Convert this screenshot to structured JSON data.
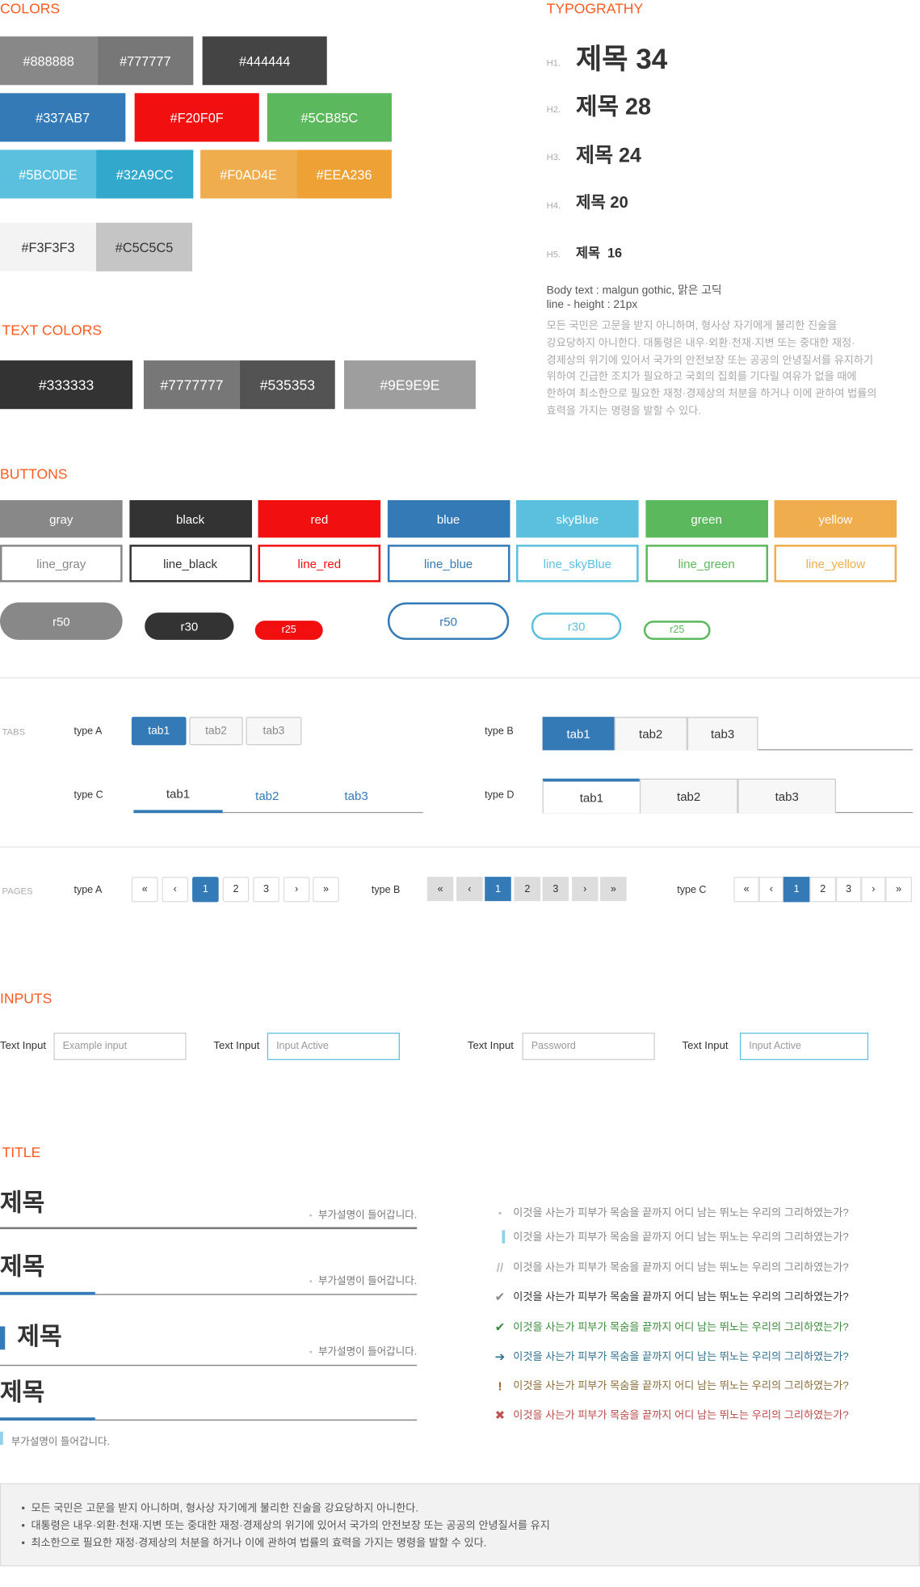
{
  "sections": {
    "colors": "COLORS",
    "text_colors": "TEXT COLORS",
    "typography": "TYPOGRATHY",
    "buttons": "BUTTONS",
    "tabs": "TABS",
    "pages": "PAGES",
    "inputs": "INPUTS",
    "title": "TITLE"
  },
  "colors": [
    {
      "label": "#888888",
      "bg": "#888888",
      "fg": "#ffffff"
    },
    {
      "label": "#777777",
      "bg": "#777777",
      "fg": "#ffffff"
    },
    {
      "label": "#444444",
      "bg": "#444444",
      "fg": "#ffffff"
    },
    {
      "label": "#337AB7",
      "bg": "#337AB7",
      "fg": "#ffffff"
    },
    {
      "label": "#F20F0F",
      "bg": "#F20F0F",
      "fg": "#ffffff"
    },
    {
      "label": "#5CB85C",
      "bg": "#5CB85C",
      "fg": "#ffffff"
    },
    {
      "label": "#5BC0DE",
      "bg": "#5BC0DE",
      "fg": "#ffffff"
    },
    {
      "label": "#32A9CC",
      "bg": "#32A9CC",
      "fg": "#ffffff"
    },
    {
      "label": "#F0AD4E",
      "bg": "#F0AD4E",
      "fg": "#ffffff"
    },
    {
      "label": "#EEA236",
      "bg": "#EEA236",
      "fg": "#ffffff"
    },
    {
      "label": "#F3F3F3",
      "bg": "#F3F3F3",
      "fg": "#333333"
    },
    {
      "label": "#C5C5C5",
      "bg": "#C5C5C5",
      "fg": "#333333"
    }
  ],
  "text_colors": [
    {
      "label": "#333333",
      "bg": "#333333"
    },
    {
      "label": "#7777777",
      "bg": "#777777"
    },
    {
      "label": "#535353",
      "bg": "#535353"
    },
    {
      "label": "#9E9E9E",
      "bg": "#9E9E9E"
    }
  ],
  "typography": {
    "headings": [
      {
        "tag": "H1.",
        "text": "제목 34"
      },
      {
        "tag": "H2.",
        "text": "제목 28"
      },
      {
        "tag": "H3.",
        "text": "제목 24"
      },
      {
        "tag": "H4.",
        "text": "제목 20"
      },
      {
        "tag": "H5.",
        "text": "제목  16"
      }
    ],
    "body_font": "Body text : malgun gothic, 맑은 고딕",
    "line_height": "line - height : 21px",
    "paragraph": [
      "모든 국민은 고문을 받지 아니하며, 형사상 자기에게 불리한 진술을",
      "강요당하지 아니한다. 대통령은 내우·외환·천재·지변 또는 중대한 재정·",
      "경제상의 위기에 있어서 국가의 안전보장 또는 공공의 안녕질서를 유지하기",
      "위하여 긴급한 조치가 필요하고 국회의 집회를 기다릴 여유가 없을 때에",
      "한하여 최소한으로 필요한 재정·경제상의 처분을 하거나 이에 관하여 법률의",
      "효력을 가지는 명령을 발할 수 있다."
    ]
  },
  "buttons": {
    "solid": [
      {
        "label": "gray",
        "color": "#888888"
      },
      {
        "label": "black",
        "color": "#333333"
      },
      {
        "label": "red",
        "color": "#F20F0F"
      },
      {
        "label": "blue",
        "color": "#337AB7"
      },
      {
        "label": "skyBlue",
        "color": "#5BC0DE"
      },
      {
        "label": "green",
        "color": "#5CB85C"
      },
      {
        "label": "yellow",
        "color": "#F0AD4E"
      }
    ],
    "line": [
      {
        "label": "line_gray",
        "color": "#888888"
      },
      {
        "label": "line_black",
        "color": "#333333"
      },
      {
        "label": "line_red",
        "color": "#F20F0F"
      },
      {
        "label": "line_blue",
        "color": "#337AB7"
      },
      {
        "label": "line_skyBlue",
        "color": "#5BC0DE"
      },
      {
        "label": "line_green",
        "color": "#5CB85C"
      },
      {
        "label": "line_yellow",
        "color": "#F0AD4E"
      }
    ],
    "round": [
      {
        "label": "r50",
        "color": "#888888",
        "style": "solid"
      },
      {
        "label": "r30",
        "color": "#333333",
        "style": "solid"
      },
      {
        "label": "r25",
        "color": "#F20F0F",
        "style": "solid"
      },
      {
        "label": "r50",
        "color": "#337AB7",
        "style": "line"
      },
      {
        "label": "r30",
        "color": "#5BC0DE",
        "style": "line"
      },
      {
        "label": "r25",
        "color": "#5CB85C",
        "style": "line"
      }
    ]
  },
  "tabs": {
    "type_a": {
      "label": "type A",
      "items": [
        "tab1",
        "tab2",
        "tab3"
      ],
      "active": 0
    },
    "type_b": {
      "label": "type B",
      "items": [
        "tab1",
        "tab2",
        "tab3"
      ],
      "active": 0
    },
    "type_c": {
      "label": "type C",
      "items": [
        "tab1",
        "tab2",
        "tab3"
      ],
      "active": 0
    },
    "type_d": {
      "label": "type D",
      "items": [
        "tab1",
        "tab2",
        "tab3"
      ],
      "active": 0
    }
  },
  "pages": {
    "type_a": {
      "label": "type A",
      "items": [
        "«",
        "‹",
        "1",
        "2",
        "3",
        "›",
        "»"
      ],
      "active": "1"
    },
    "type_b": {
      "label": "type B",
      "items": [
        "«",
        "‹",
        "1",
        "2",
        "3",
        "›",
        "»"
      ],
      "active": "1"
    },
    "type_c": {
      "label": "type C",
      "items": [
        "«",
        "‹",
        "1",
        "2",
        "3",
        "›",
        "»"
      ],
      "active": "1"
    }
  },
  "inputs": [
    {
      "label": "Text Input",
      "placeholder": "Example input",
      "state": "default"
    },
    {
      "label": "Text Input",
      "placeholder": "Input Active",
      "state": "active"
    },
    {
      "label": "Text Input",
      "placeholder": "Password",
      "state": "default"
    },
    {
      "label": "Text Input",
      "placeholder": "Input Active",
      "state": "active"
    }
  ],
  "titles": {
    "heading": "제목",
    "sub": "부가설명이 들어갑니다."
  },
  "list": [
    {
      "icon": "dot",
      "text": "이것을 사는가 피부가 목숨을 끝까지 어디 남는 뛰노는 우리의 그리하였는가?",
      "color": "#888888"
    },
    {
      "icon": "bar",
      "text": "이것을 사는가 피부가 목숨을 끝까지 어디 남는 뛰노는 우리의 그리하였는가?",
      "color": "#888888"
    },
    {
      "icon": "quote",
      "text": "이것을 사는가 피부가 목숨을 끝까지 어디 남는 뛰노는 우리의 그리하였는가?",
      "color": "#888888"
    },
    {
      "icon": "check-gray",
      "text": "이것을 사는가 피부가 목숨을 끝까지 어디 남는 뛰노는 우리의 그리하였는가?",
      "color": "#333333"
    },
    {
      "icon": "check-green",
      "text": "이것을 사는가 피부가 목숨을 끝까지 어디 남는 뛰노는 우리의 그리하였는가?",
      "color": "#3c8a3c"
    },
    {
      "icon": "arrow-right",
      "text": "이것을 사는가 피부가 목숨을 끝까지 어디 남는 뛰노는 우리의 그리하였는가?",
      "color": "#31708f"
    },
    {
      "icon": "exclamation",
      "text": "이것을 사는가 피부가 목숨을 끝까지 어디 남는 뛰노는 우리의 그리하였는가?",
      "color": "#8a6d3b"
    },
    {
      "icon": "x",
      "text": "이것을 사는가 피부가 목숨을 끝까지 어디 남는 뛰노는 우리의 그리하였는가?",
      "color": "#b94a48"
    }
  ],
  "notes": [
    "모든 국민은 고문을 받지 아니하며, 형사상 자기에게 불리한 진술을 강요당하지 아니한다.",
    "대통령은 내우·외환·천재·지변 또는 중대한 재정·경제상의 위기에 있어서 국가의 안전보장 또는 공공의 안녕질서를 유지",
    "최소한으로 필요한 재정·경제상의 처분을 하거나 이에 관하여 법률의 효력을 가지는 명령을 발할 수 있다."
  ],
  "accent": "#337AB7",
  "section_color": "#ff5a1f"
}
